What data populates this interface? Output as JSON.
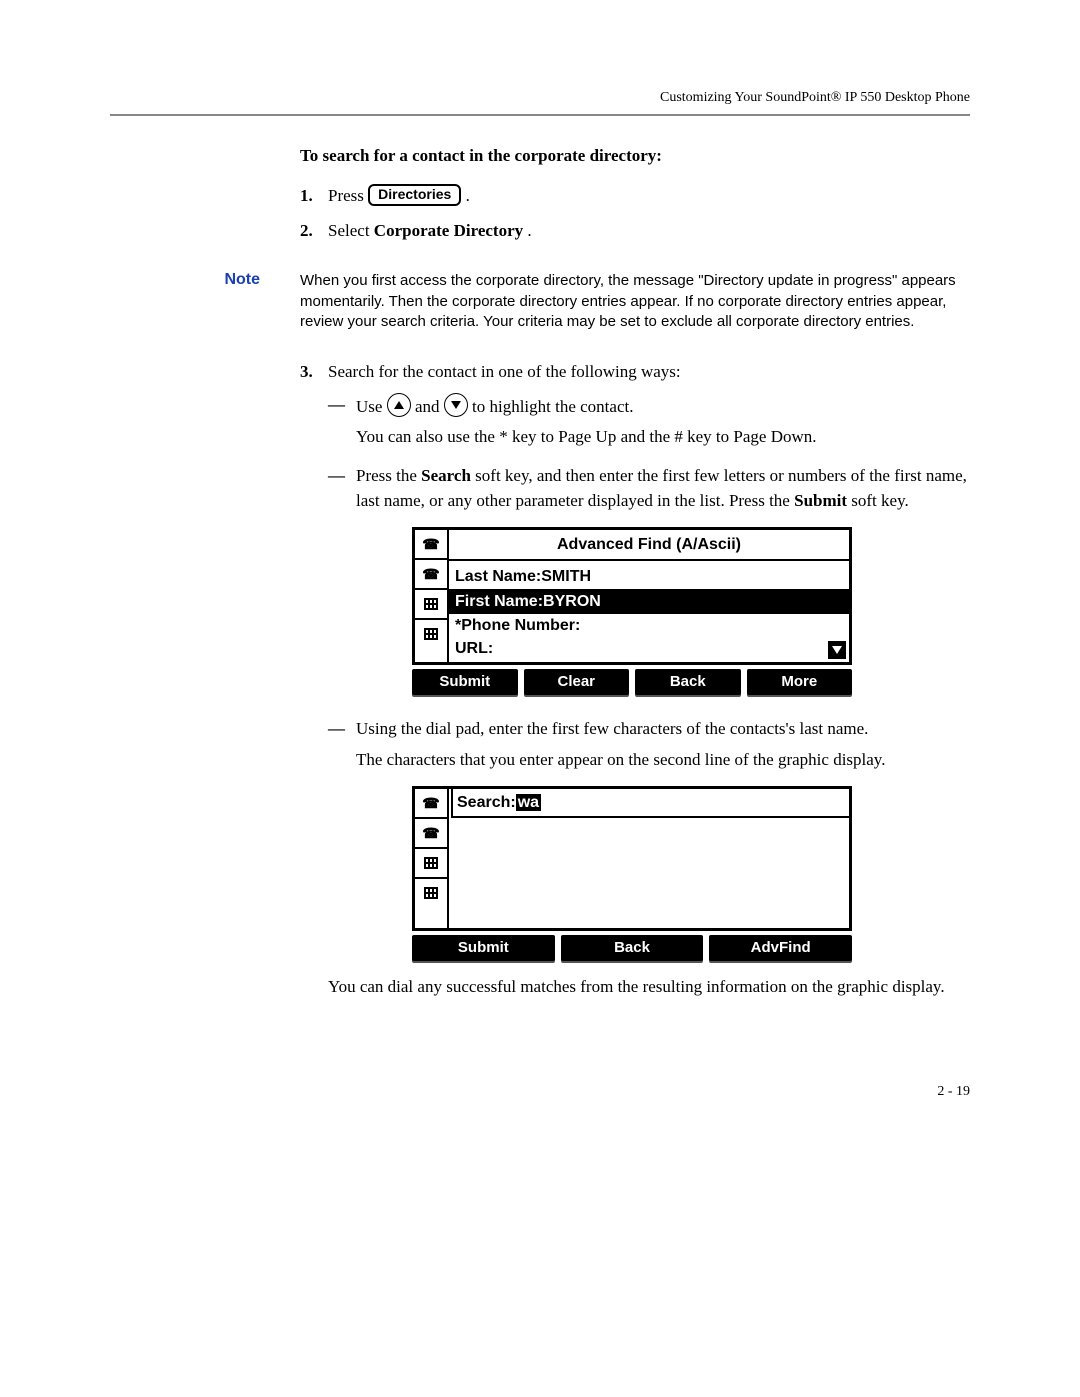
{
  "header": {
    "running_head": "Customizing Your SoundPoint® IP 550 Desktop Phone"
  },
  "section": {
    "heading": "To search for a contact in the corporate directory:"
  },
  "steps": {
    "s1_num": "1.",
    "s1_a": "Press ",
    "s1_btn": "Directories",
    "s1_b": " .",
    "s2_num": "2.",
    "s2_a": "Select ",
    "s2_bold": "Corporate Directory",
    "s2_b": ".",
    "s3_num": "3.",
    "s3_text": "Search for the contact in one of the following ways:"
  },
  "note": {
    "label": "Note",
    "body": "When you first access the corporate directory, the message \"Directory update in progress\" appears momentarily. Then the corporate directory entries appear. If no corporate directory entries appear, review your search criteria. Your criteria may be set to exclude all corporate directory entries."
  },
  "bullets": {
    "b1_a": "Use ",
    "b1_b": " and ",
    "b1_c": " to highlight the contact.",
    "b1_para2": "You can also use the * key to Page Up and the # key to Page Down.",
    "b2_a": "Press the ",
    "b2_bold1": "Search",
    "b2_b": " soft key, and then enter the first few letters or numbers of the first name, last name, or any other parameter displayed in the list. Press the ",
    "b2_bold2": "Submit",
    "b2_c": " soft key.",
    "b3_text": "Using the dial pad, enter the first few characters of the contacts's last name.",
    "b3_para2": "The characters that you enter appear on the second line of the graphic display."
  },
  "lcd1": {
    "title": "Advanced Find (A/Ascii)",
    "row1_label": "Last Name:",
    "row1_value": "SMITH",
    "row2_label": "First Name:",
    "row2_value": "BYRON",
    "row3_label": "*Phone Number:",
    "row4_label": "URL:",
    "softkeys": [
      "Submit",
      "Clear",
      "Back",
      "More"
    ]
  },
  "lcd2": {
    "search_label": "Search:",
    "search_value": "wa",
    "softkeys": [
      "Submit",
      "Back",
      "AdvFind"
    ]
  },
  "tail": {
    "text": "You can dial any successful matches from the resulting information on the graphic display."
  },
  "footer": {
    "page": "2 - 19"
  }
}
